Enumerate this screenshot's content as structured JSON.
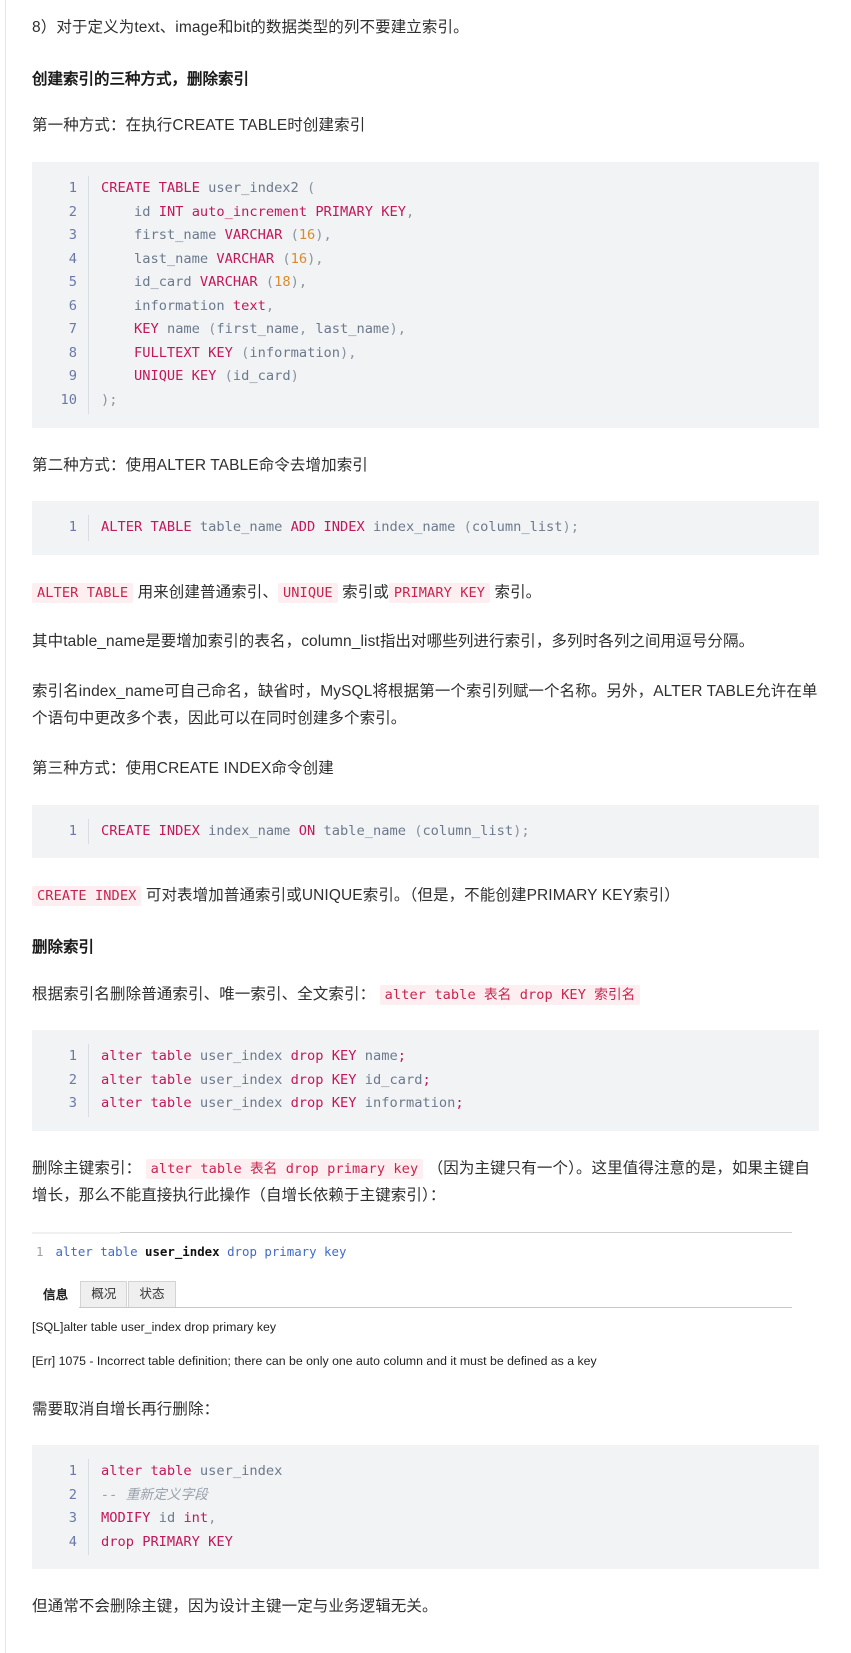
{
  "document": {
    "intro_item": "8）对于定义为text、image和bit的数据类型的列不要建立索引。",
    "section_heading": "创建索引的三种方式，删除索引",
    "method1_label": "第一种方式：在执行CREATE TABLE时创建索引",
    "method2_label": "第二种方式：使用ALTER TABLE命令去增加索引",
    "method3_label": "第三种方式：使用CREATE INDEX命令创建",
    "drop_heading": "删除索引",
    "drop_by_name_prefix": "根据索引名删除普通索引、唯一索引、全文索引：",
    "drop_by_name_code": "alter table 表名 drop KEY 索引名",
    "alter_note_code1": "ALTER TABLE",
    "alter_note_mid1": "用来创建普通索引、",
    "alter_note_code2": "UNIQUE",
    "alter_note_mid2": "索引或",
    "alter_note_code3": "PRIMARY KEY",
    "alter_note_tail": "索引。",
    "table_name_para": "其中table_name是要增加索引的表名，column_list指出对哪些列进行索引，多列时各列之间用逗号分隔。",
    "index_name_para": "索引名index_name可自己命名，缺省时，MySQL将根据第一个索引列赋一个名称。另外，ALTER TABLE允许在单个语句中更改多个表，因此可以在同时创建多个索引。",
    "create_index_note_code": "CREATE INDEX",
    "create_index_note_tail": "可对表增加普通索引或UNIQUE索引。（但是，不能创建PRIMARY KEY索引）",
    "drop_pk_prefix": "删除主键索引：",
    "drop_pk_code": "alter table 表名 drop primary key",
    "drop_pk_tail": "（因为主键只有一个）。这里值得注意的是，如果主键自增长，那么不能直接执行此操作（自增长依赖于主键索引）：",
    "need_cancel_ai": "需要取消自增长再行删除：",
    "closing_para": "但通常不会删除主键，因为设计主键一定与业务逻辑无关。"
  },
  "code_blocks": {
    "create_table": {
      "line_numbers": "1\n2\n3\n4\n5\n6\n7\n8\n9\n10",
      "lines": [
        "CREATE TABLE user_index2 (",
        "    id INT auto_increment PRIMARY KEY,",
        "    first_name VARCHAR (16),",
        "    last_name VARCHAR (16),",
        "    id_card VARCHAR (18),",
        "    information text,",
        "    KEY name (first_name, last_name),",
        "    FULLTEXT KEY (information),",
        "    UNIQUE KEY (id_card)",
        ");"
      ]
    },
    "alter_add_index": {
      "line_numbers": "1",
      "lines": [
        "ALTER TABLE table_name ADD INDEX index_name (column_list);"
      ]
    },
    "create_index": {
      "line_numbers": "1",
      "lines": [
        "CREATE INDEX index_name ON table_name (column_list);"
      ]
    },
    "drop_keys": {
      "line_numbers": "1\n2\n3",
      "lines": [
        "alter table user_index drop KEY name;",
        "alter table user_index drop KEY id_card;",
        "alter table user_index drop KEY information;"
      ]
    },
    "modify_drop_pk": {
      "line_numbers": "1\n2\n3\n4",
      "lines": [
        "alter table user_index",
        "-- 重新定义字段",
        "MODIFY id int,",
        "drop PRIMARY KEY"
      ]
    }
  },
  "embedded_client": {
    "editor_line_number": "1",
    "editor_sql": "alter table user_index drop primary key",
    "tabs": [
      {
        "label": "信息",
        "active": true
      },
      {
        "label": "概况",
        "active": false
      },
      {
        "label": "状态",
        "active": false
      }
    ],
    "log_sql": "[SQL]alter table user_index drop primary key",
    "log_error": "[Err] 1075 - Incorrect table definition; there can be only one auto column and it must be defined as a key"
  },
  "colors": {
    "keyword": "#c2185b",
    "identifier": "#6b7a8d",
    "number": "#d98b29",
    "comment": "#9aa1ab",
    "inline_code_bg": "#fdeef2",
    "inline_code_fg": "#c7254e",
    "code_block_bg": "#f2f3f5",
    "gutter_fg": "#6a7aa8",
    "embed_keyword": "#4169c9"
  }
}
